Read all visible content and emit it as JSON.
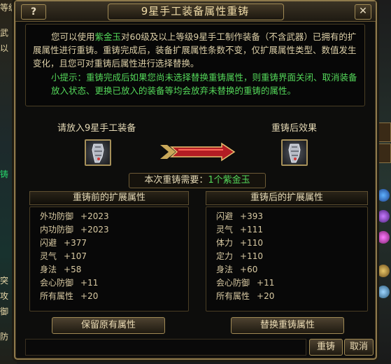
{
  "background": {
    "left_text": [
      {
        "text": "等级",
        "color": "normal"
      },
      {
        "text": "武",
        "color": "normal"
      },
      {
        "text": "以",
        "color": "normal"
      },
      {
        "text": "铸",
        "color": "green"
      },
      {
        "text": "突",
        "color": "normal"
      },
      {
        "text": "攻",
        "color": "normal"
      },
      {
        "text": "御",
        "color": "normal"
      },
      {
        "text": "防",
        "color": "normal"
      }
    ]
  },
  "window": {
    "help_label": "?",
    "title": "9星手工装备属性重铸",
    "close_label": "✕"
  },
  "description": {
    "line1_a": "您可以使用",
    "line1_item": "紫金玉",
    "line1_b": "对60级及以上等级9星手工制作装备（不含武器）已拥有的扩展属性进行重铸。重铸完成后，装备扩展属性条数不变，仅扩展属性类型、数值发生变化，且您可对重铸后属性进行选择替换。",
    "tip": "小提示：重铸完成后如果您尚未选择替换重铸属性，则重铸界面关闭、取消装备放入状态、更换已放入的装备等均会放弃未替换的重铸的属性。"
  },
  "slots": {
    "input_label": "请放入9星手工装备",
    "output_label": "重铸后效果"
  },
  "cost": {
    "prefix": "本次重铸需要：",
    "amount_item": "1个紫金玉"
  },
  "before": {
    "header": "重铸前的扩展属性",
    "attrs": [
      {
        "name": "外功防御",
        "value": "+2023"
      },
      {
        "name": "内功防御",
        "value": "+2023"
      },
      {
        "name": "闪避",
        "value": "+377"
      },
      {
        "name": "灵气",
        "value": "+107"
      },
      {
        "name": "身法",
        "value": "+58"
      },
      {
        "name": "会心防御",
        "value": "+11"
      },
      {
        "name": "所有属性",
        "value": "+20"
      }
    ],
    "button": "保留原有属性"
  },
  "after": {
    "header": "重铸后的扩展属性",
    "attrs": [
      {
        "name": "闪避",
        "value": "+393"
      },
      {
        "name": "灵气",
        "value": "+111"
      },
      {
        "name": "体力",
        "value": "+110"
      },
      {
        "name": "定力",
        "value": "+110"
      },
      {
        "name": "身法",
        "value": "+60"
      },
      {
        "name": "会心防御",
        "value": "+11"
      },
      {
        "name": "所有属性",
        "value": "+20"
      }
    ],
    "button": "替换重铸属性"
  },
  "footer": {
    "recast_button": "重铸",
    "cancel_button": "取消"
  },
  "colors": {
    "gold_border": "#8f7a4c",
    "highlight_green": "#54d85a",
    "text": "#dccfa7"
  }
}
